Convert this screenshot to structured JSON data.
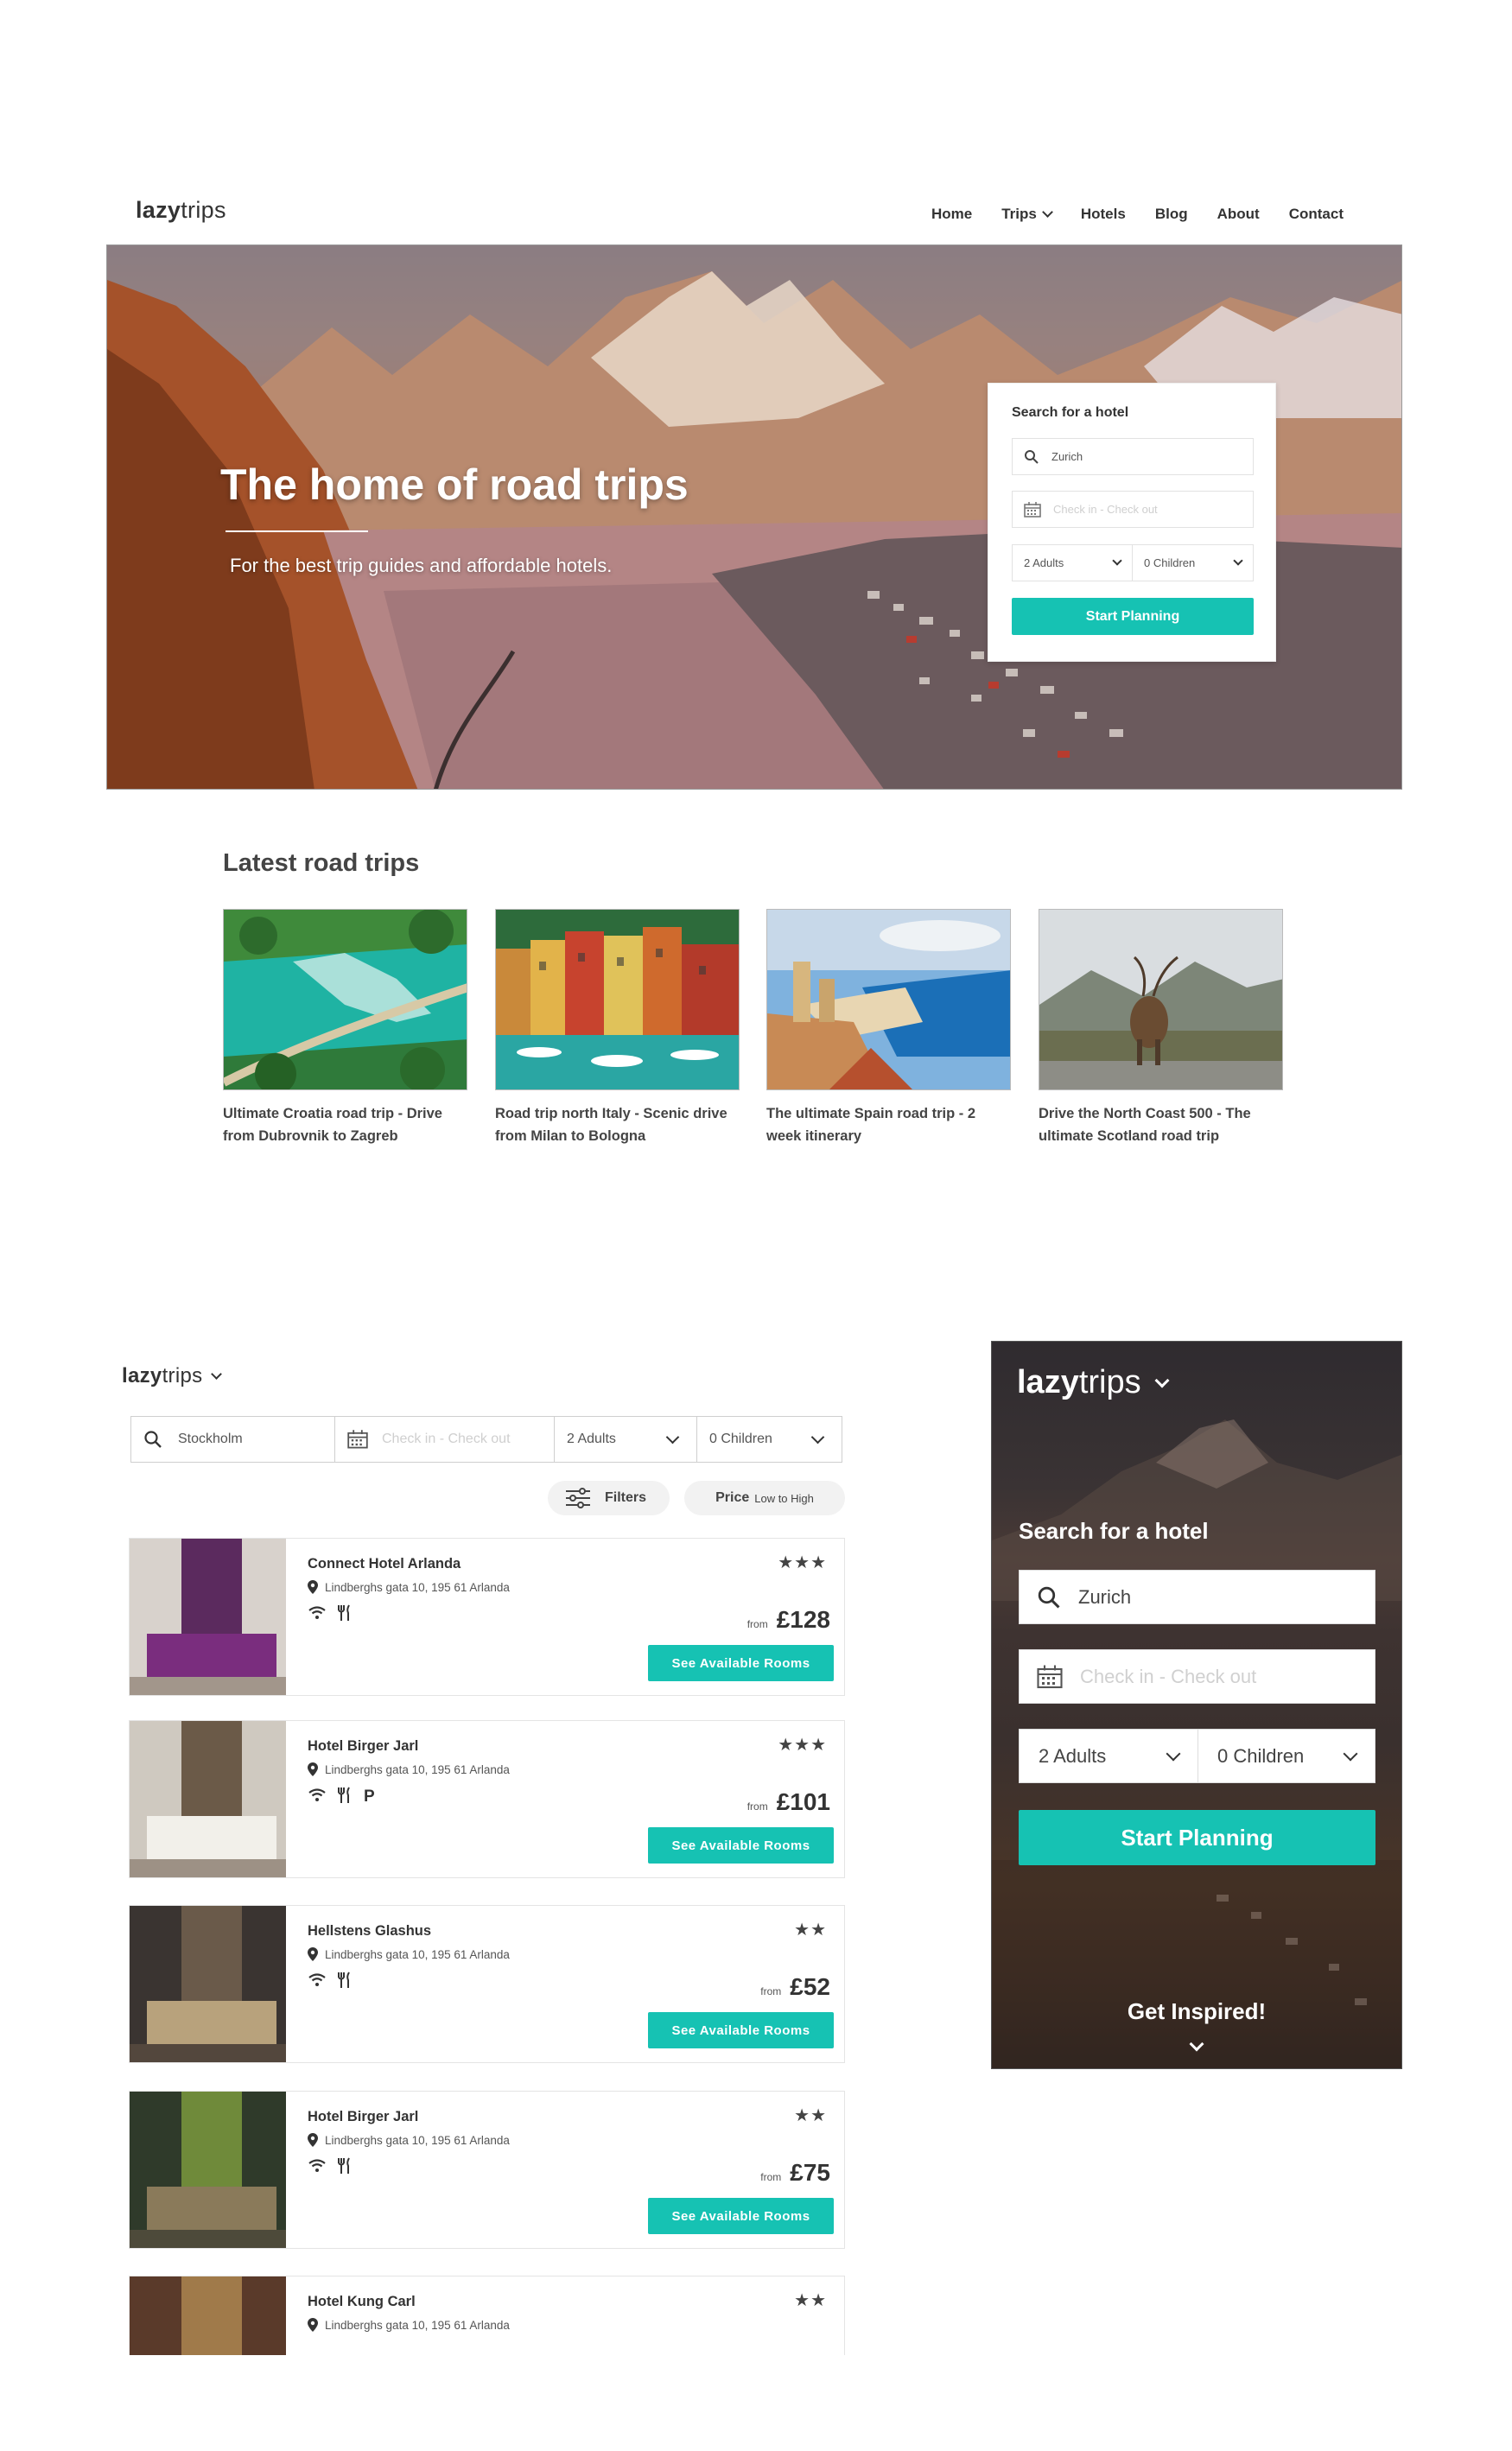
{
  "desktop": {
    "logo": {
      "bold": "lazy",
      "light": "trips"
    },
    "nav": [
      {
        "label": "Home"
      },
      {
        "label": "Trips",
        "has_dropdown": true
      },
      {
        "label": "Hotels"
      },
      {
        "label": "Blog"
      },
      {
        "label": "About"
      },
      {
        "label": "Contact"
      }
    ],
    "hero": {
      "title": "The home of road trips",
      "subtitle": "For the best trip guides and affordable hotels."
    },
    "search": {
      "title": "Search for a hotel",
      "location_value": "Zurich",
      "dates_placeholder": "Check in - Check out",
      "adults": "2 Adults",
      "children": "0 Children",
      "button": "Start Planning"
    },
    "latest": {
      "title": "Latest road trips",
      "trips": [
        {
          "title": "Ultimate Croatia road trip - Drive from Dubrovnik to Zagreb"
        },
        {
          "title": "Road trip north Italy - Scenic drive from Milan to Bologna"
        },
        {
          "title": "The ultimate Spain road trip - 2 week itinerary"
        },
        {
          "title": "Drive the North Coast 500 - The ultimate Scotland road trip"
        }
      ]
    }
  },
  "mobile_list": {
    "logo": {
      "bold": "lazy",
      "light": "trips"
    },
    "search": {
      "location_value": "Stockholm",
      "dates_placeholder": "Check in - Check out",
      "adults": "2 Adults",
      "children": "0 Children"
    },
    "filters_label": "Filters",
    "sort": {
      "bold": "Price",
      "light": "Low to High"
    },
    "hotels": [
      {
        "name": "Connect Hotel Arlanda",
        "address": "Lindberghs gata 10, 195 61  Arlanda",
        "stars": "★★★",
        "from": "from",
        "price": "£128",
        "button": "See Available Rooms",
        "amenities": [
          "wifi-icon",
          "restaurant-icon"
        ]
      },
      {
        "name": "Hotel Birger Jarl",
        "address": "Lindberghs gata 10, 195 61  Arlanda",
        "stars": "★★★",
        "from": "from",
        "price": "£101",
        "button": "See Available Rooms",
        "amenities": [
          "wifi-icon",
          "restaurant-icon",
          "parking-icon"
        ]
      },
      {
        "name": "Hellstens Glashus",
        "address": "Lindberghs gata 10, 195 61  Arlanda",
        "stars": "★★",
        "from": "from",
        "price": "£52",
        "button": "See Available Rooms",
        "amenities": [
          "wifi-icon",
          "restaurant-icon"
        ]
      },
      {
        "name": "Hotel Birger Jarl",
        "address": "Lindberghs gata 10, 195 61  Arlanda",
        "stars": "★★",
        "from": "from",
        "price": "£75",
        "button": "See Available Rooms",
        "amenities": [
          "wifi-icon",
          "restaurant-icon"
        ]
      },
      {
        "name": "Hotel Kung Carl",
        "address": "Lindberghs gata 10, 195 61  Arlanda",
        "stars": "★★",
        "from": "",
        "price": "",
        "button": "",
        "amenities": []
      }
    ]
  },
  "mobile_hero": {
    "logo": {
      "bold": "lazy",
      "light": "trips"
    },
    "title": "Search for a hotel",
    "location_value": "Zurich",
    "dates_placeholder": "Check in - Check out",
    "adults": "2 Adults",
    "children": "0 Children",
    "button": "Start Planning",
    "inspired": "Get Inspired!"
  },
  "colors": {
    "accent": "#16c2b3",
    "text": "#333333",
    "border": "#e2e2e2"
  }
}
